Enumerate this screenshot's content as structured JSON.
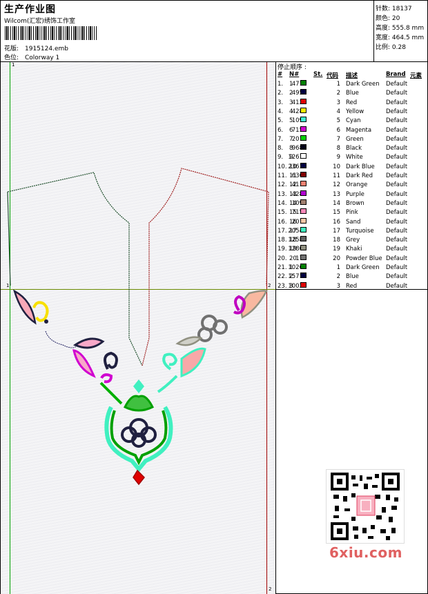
{
  "header": {
    "title": "生产作业图",
    "subtitle": "Wilcom(汇宏)绣饰工作室",
    "file_label": "花版:",
    "file_value": "1915124.emb",
    "colorway_label": "色位:",
    "colorway_value": "Colorway 1"
  },
  "stats": {
    "stitches_label": "针数:",
    "stitches_value": "18137",
    "colors_label": "颜色:",
    "colors_value": "20",
    "height_label": "高度:",
    "height_value": "555.8 mm",
    "width_label": "宽度:",
    "width_value": "464.5 mm",
    "scale_label": "比例:",
    "scale_value": "0.28"
  },
  "markers": {
    "start": "1",
    "end": "2",
    "left_line": "1",
    "right_line": "2"
  },
  "sequence": {
    "title": "停止顺序 :",
    "headers": {
      "idx": "#",
      "no": "N#",
      "st": "St.",
      "code": "代码",
      "desc": "描述",
      "brand": "Brand",
      "elem": "元素"
    },
    "rows": [
      {
        "idx": "1.",
        "no": "1",
        "color": "#008000",
        "st": "471",
        "code": "1",
        "desc": "Dark Green",
        "brand": "Default"
      },
      {
        "idx": "2.",
        "no": "2",
        "color": "#000040",
        "st": "495",
        "code": "2",
        "desc": "Blue",
        "brand": "Default"
      },
      {
        "idx": "3.",
        "no": "3",
        "color": "#e00000",
        "st": "412",
        "code": "3",
        "desc": "Red",
        "brand": "Default"
      },
      {
        "idx": "4.",
        "no": "4",
        "color": "#f8f000",
        "st": "428",
        "code": "4",
        "desc": "Yellow",
        "brand": "Default"
      },
      {
        "idx": "5.",
        "no": "5",
        "color": "#40f0d0",
        "st": "109",
        "code": "5",
        "desc": "Cyan",
        "brand": "Default"
      },
      {
        "idx": "6.",
        "no": "6",
        "color": "#d000d0",
        "st": "715",
        "code": "6",
        "desc": "Magenta",
        "brand": "Default"
      },
      {
        "idx": "7.",
        "no": "7",
        "color": "#00d000",
        "st": "201",
        "code": "7",
        "desc": "Green",
        "brand": "Default"
      },
      {
        "idx": "8.",
        "no": "8",
        "color": "#000018",
        "st": "968",
        "code": "8",
        "desc": "Black",
        "brand": "Default"
      },
      {
        "idx": "9.",
        "no": "9",
        "color": "#ffffff",
        "st": "1263",
        "code": "9",
        "desc": "White",
        "brand": "Default"
      },
      {
        "idx": "10.",
        "no": "10",
        "color": "#000040",
        "st": "2363",
        "code": "10",
        "desc": "Dark Blue",
        "brand": "Default"
      },
      {
        "idx": "11.",
        "no": "11",
        "color": "#800000",
        "st": "636",
        "code": "11",
        "desc": "Dark Red",
        "brand": "Default"
      },
      {
        "idx": "12.",
        "no": "12",
        "color": "#f08070",
        "st": "413",
        "code": "12",
        "desc": "Orange",
        "brand": "Default"
      },
      {
        "idx": "13.",
        "no": "13",
        "color": "#b000d0",
        "st": "428",
        "code": "13",
        "desc": "Purple",
        "brand": "Default"
      },
      {
        "idx": "14.",
        "no": "14",
        "color": "#a08070",
        "st": "109",
        "code": "14",
        "desc": "Brown",
        "brand": "Default"
      },
      {
        "idx": "15.",
        "no": "15",
        "color": "#f888b8",
        "st": "715",
        "code": "15",
        "desc": "Pink",
        "brand": "Default"
      },
      {
        "idx": "16.",
        "no": "16",
        "color": "#f8c8a8",
        "st": "201",
        "code": "16",
        "desc": "Sand",
        "brand": "Default"
      },
      {
        "idx": "17.",
        "no": "17",
        "color": "#40f0c0",
        "st": "2054",
        "code": "17",
        "desc": "Turquoise",
        "brand": "Default"
      },
      {
        "idx": "18.",
        "no": "18",
        "color": "#606060",
        "st": "1258",
        "code": "18",
        "desc": "Grey",
        "brand": "Default"
      },
      {
        "idx": "19.",
        "no": "19",
        "color": "#909080",
        "st": "1280",
        "code": "19",
        "desc": "Khaki",
        "brand": "Default"
      },
      {
        "idx": "20.",
        "no": "20",
        "color": "#707070",
        "st": "17",
        "code": "20",
        "desc": "Powder Blue",
        "brand": "Default"
      },
      {
        "idx": "21.",
        "no": "1",
        "color": "#008000",
        "st": "1026",
        "code": "1",
        "desc": "Dark Green",
        "brand": "Default"
      },
      {
        "idx": "22.",
        "no": "2",
        "color": "#000040",
        "st": "1571",
        "code": "2",
        "desc": "Blue",
        "brand": "Default"
      },
      {
        "idx": "23.",
        "no": "3",
        "color": "#e00000",
        "st": "1002",
        "code": "3",
        "desc": "Red",
        "brand": "Default"
      }
    ]
  },
  "watermark": {
    "text": "6xiu.com",
    "color": "#e06060"
  },
  "colors": {
    "frame_left": "#00a000",
    "frame_right": "#a00000",
    "center_line": "#6a8a00"
  }
}
